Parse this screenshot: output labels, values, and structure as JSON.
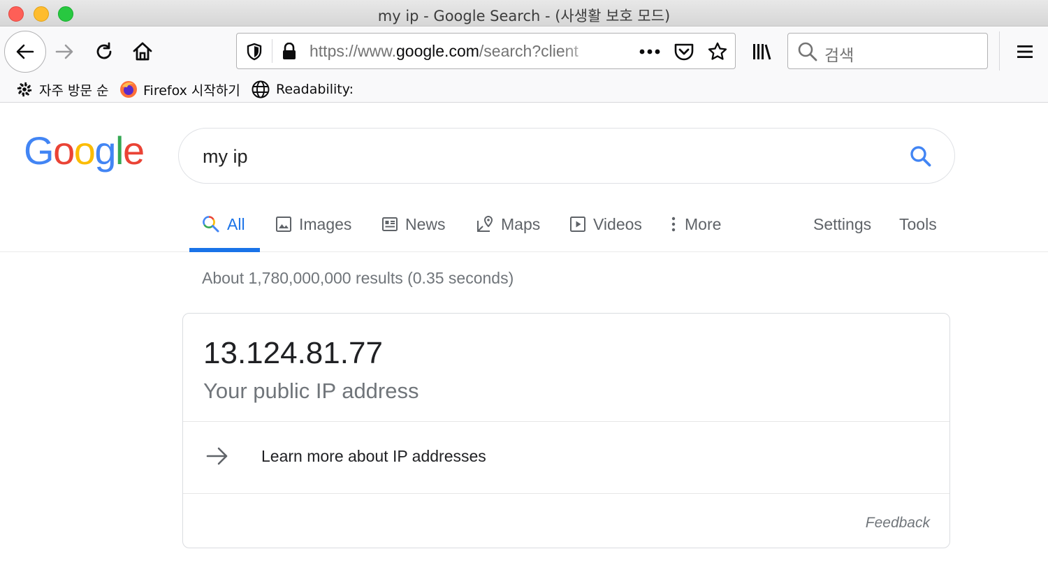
{
  "window": {
    "title": "my ip - Google Search - (사생활 보호 모드)"
  },
  "toolbar": {
    "url_prefix": "https://www.",
    "url_host": "google.com",
    "url_path": "/search?client",
    "search_placeholder": "검색",
    "icons": [
      "back-icon",
      "forward-icon",
      "reload-icon",
      "home-icon",
      "shield-icon",
      "lock-icon",
      "more-icon",
      "pocket-icon",
      "star-icon",
      "library-icon",
      "search-icon",
      "hamburger-menu-icon"
    ]
  },
  "bookmarks": [
    {
      "label": "자주 방문 순",
      "icon": "gear-icon"
    },
    {
      "label": "Firefox 시작하기",
      "icon": "firefox-icon"
    },
    {
      "label": "Readability:",
      "icon": "globe-icon"
    }
  ],
  "google": {
    "logo_letters": [
      "G",
      "o",
      "o",
      "g",
      "l",
      "e"
    ],
    "logo_colors": [
      "#4285F4",
      "#EA4335",
      "#FBBC05",
      "#4285F4",
      "#34A853",
      "#EA4335"
    ],
    "query": "my ip",
    "tabs": [
      {
        "label": "All",
        "active": true
      },
      {
        "label": "Images",
        "active": false
      },
      {
        "label": "News",
        "active": false
      },
      {
        "label": "Maps",
        "active": false
      },
      {
        "label": "Videos",
        "active": false
      },
      {
        "label": "More",
        "active": false
      }
    ],
    "settings_label": "Settings",
    "tools_label": "Tools",
    "result_stats": "About 1,780,000,000 results (0.35 seconds)",
    "ip_card": {
      "ip": "13.124.81.77",
      "subtitle": "Your public IP address",
      "learn_more": "Learn more about IP addresses",
      "feedback": "Feedback"
    },
    "accent_color": "#1a73e8"
  }
}
